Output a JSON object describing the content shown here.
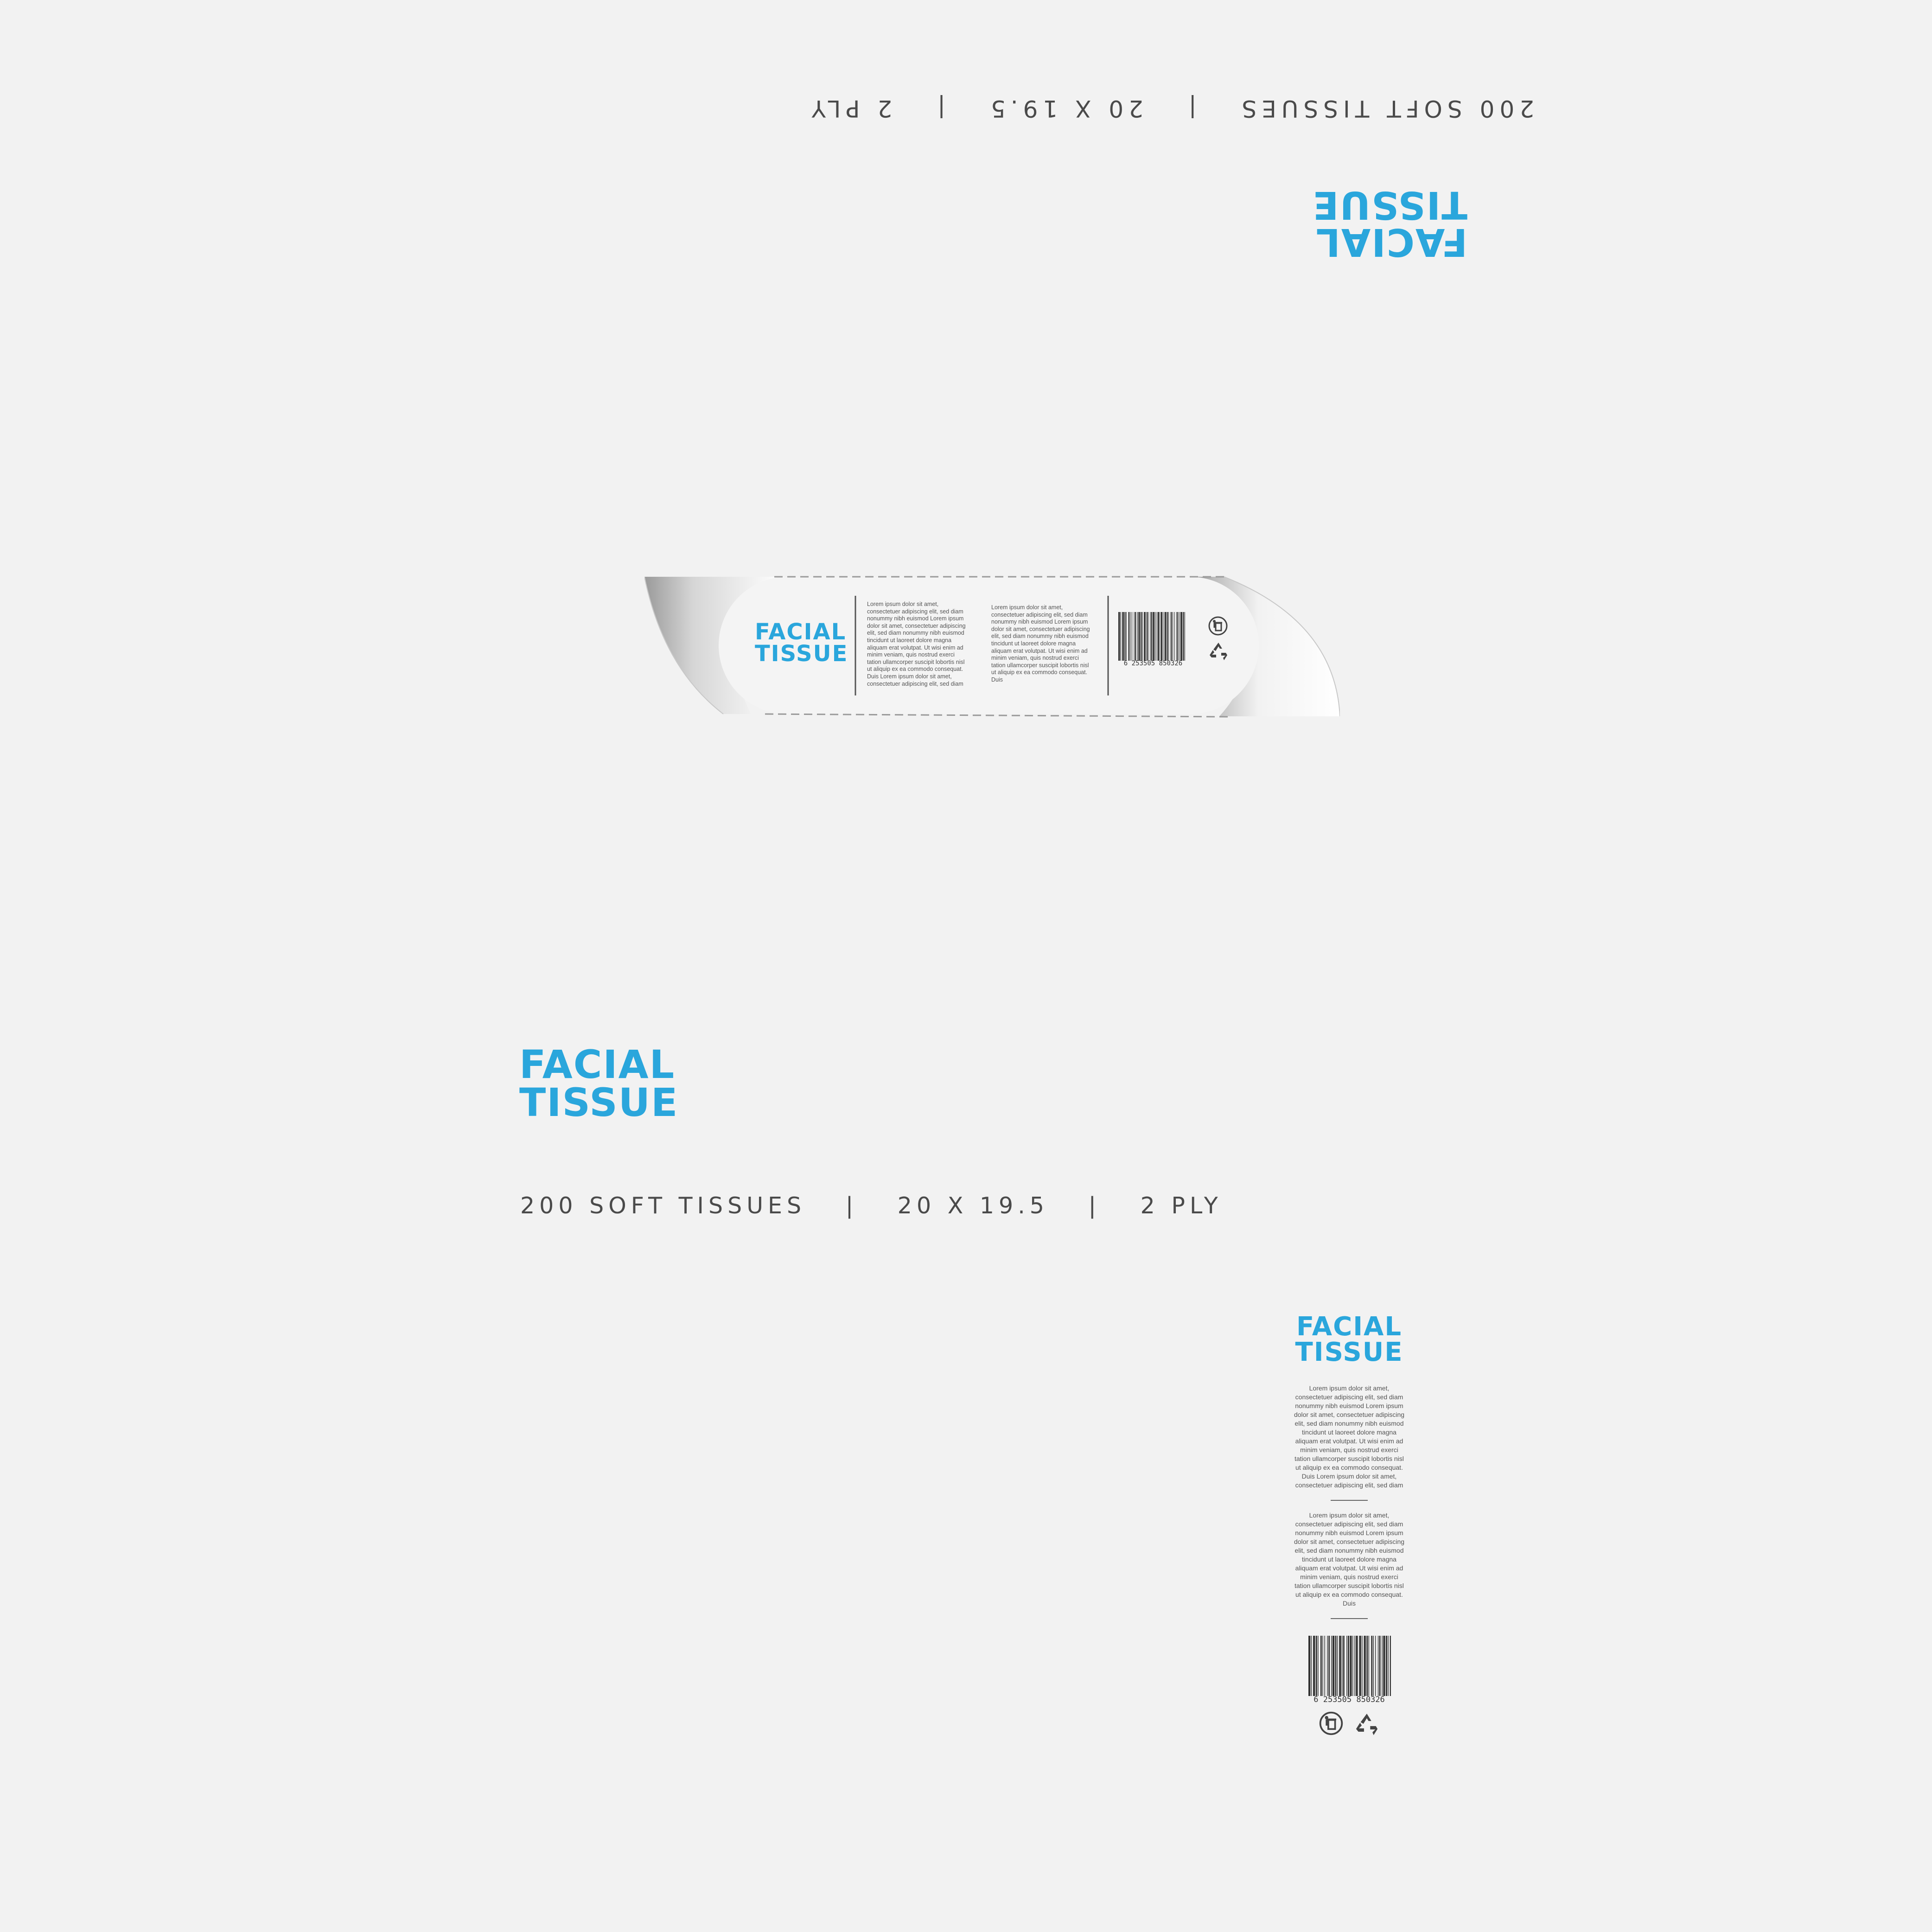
{
  "brand": {
    "title_line1": "FACIAL",
    "title_line2": "TISSUE",
    "accent_color": "#2aa6dc",
    "background_color": "#f2f2f2"
  },
  "specs": {
    "count": "200 SOFT TISSUES",
    "size": "20 X 19.5",
    "ply": "2 PLY",
    "separator": "|"
  },
  "opening_label": {
    "text_col1": "Lorem ipsum dolor sit amet,\nconsectetuer adipiscing elit, sed diam\nnonummy nibh euismod Lorem ipsum\ndolor sit amet, consectetuer adipiscing\nelit, sed diam nonummy nibh euismod\ntincidunt ut laoreet dolore magna\naliquam erat volutpat. Ut wisi enim ad\nminim veniam, quis nostrud exerci\ntation ullamcorper suscipit lobortis nisl\nut aliquip ex ea commodo consequat.\nDuis Lorem ipsum dolor sit amet,\nconsectetuer adipiscing elit, sed diam",
    "text_col2": "Lorem ipsum dolor sit amet,\nconsectetuer adipiscing elit, sed diam\nnonummy nibh euismod Lorem ipsum\ndolor sit amet, consectetuer adipiscing\nelit, sed diam nonummy nibh euismod\ntincidunt ut laoreet dolore magna\naliquam erat volutpat. Ut wisi enim ad\nminim veniam, quis nostrud exerci\ntation ullamcorper suscipit lobortis nisl\nut aliquip ex ea commodo consequat.\nDuis"
  },
  "side_panel": {
    "text_block1": "Lorem ipsum dolor sit amet,\nconsectetuer adipiscing elit, sed diam\nnonummy nibh euismod Lorem ipsum\ndolor sit amet, consectetuer adipiscing\nelit, sed diam nonummy nibh euismod\ntincidunt ut laoreet dolore magna\naliquam erat volutpat. Ut wisi enim ad\nminim veniam, quis nostrud exerci\ntation ullamcorper suscipit lobortis nisl\nut aliquip ex ea commodo consequat.\nDuis Lorem ipsum dolor sit amet,\nconsectetuer adipiscing elit, sed diam",
    "text_block2": "Lorem ipsum dolor sit amet,\nconsectetuer adipiscing elit, sed diam\nnonummy nibh euismod Lorem ipsum\ndolor sit amet, consectetuer adipiscing\nelit, sed diam nonummy nibh euismod\ntincidunt ut laoreet dolore magna\naliquam erat volutpat. Ut wisi enim ad\nminim veniam, quis nostrud exerci\ntation ullamcorper suscipit lobortis nisl\nut aliquip ex ea commodo consequat.\nDuis"
  },
  "barcode": {
    "digits": "6 253505 850326"
  },
  "icons": [
    "trash-bin-disposal-icon",
    "recycle-icon"
  ]
}
